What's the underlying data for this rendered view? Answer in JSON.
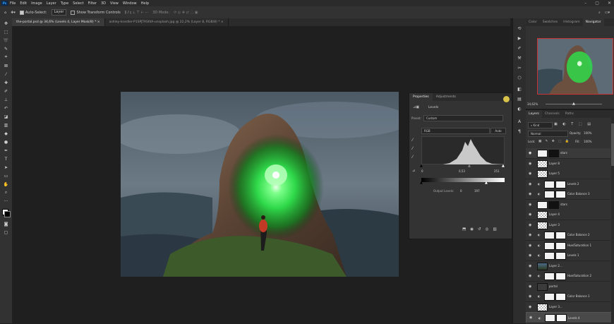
{
  "menu": {
    "app_logo": "Ps",
    "items": [
      "File",
      "Edit",
      "Image",
      "Layer",
      "Type",
      "Select",
      "Filter",
      "3D",
      "View",
      "Window",
      "Help"
    ],
    "window_controls": [
      "–",
      "▢",
      "✕"
    ]
  },
  "options_bar": {
    "auto_select_label": "Auto-Select:",
    "auto_select_value": "Layer",
    "transform_label": "Show Transform Controls",
    "mode_3d_label": "3D Mode:"
  },
  "tabs": [
    {
      "label": "the-portal.psd @ 34,6% (Levels 4, Layer Mask/8) *",
      "active": true
    },
    {
      "label": "ashley-knedler-P1SPJTASfdA-unsplash.jpg @ 22,2% (Layer 8, RGB/8) *",
      "active": false
    }
  ],
  "properties": {
    "tab_properties": "Properties",
    "tab_adjustments": "Adjustments",
    "title": "Levels",
    "preset_label": "Preset:",
    "preset_value": "Custom",
    "channel_value": "RGB",
    "auto_label": "Auto",
    "input_black": "0",
    "input_gamma": "0,53",
    "input_white": "251",
    "output_label": "Output Levels:",
    "output_black": "0",
    "output_white": "197"
  },
  "panels": {
    "tabs": [
      "Color",
      "Swatches",
      "Histogram",
      "Navigator"
    ],
    "active": "Navigator",
    "zoom": "34,62%"
  },
  "layers": {
    "tabs": [
      "Layers",
      "Channels",
      "Paths"
    ],
    "kind_label": "Kind",
    "blend_mode": "Normal",
    "opacity_label": "Opacity:",
    "opacity_value": "100%",
    "lock_label": "Lock:",
    "fill_label": "Fill:",
    "fill_value": "100%",
    "rows": [
      {
        "name": "stars",
        "type": "mask"
      },
      {
        "name": "Layer 8",
        "type": "pixel"
      },
      {
        "name": "Layer 5",
        "type": "pixel"
      },
      {
        "name": "Levels 2",
        "type": "adjust"
      },
      {
        "name": "Color Balance 3",
        "type": "adjust"
      },
      {
        "name": "stars",
        "type": "mask"
      },
      {
        "name": "Layer 4",
        "type": "pixel"
      },
      {
        "name": "Layer 3",
        "type": "pixel"
      },
      {
        "name": "Color Balance 2",
        "type": "adjust"
      },
      {
        "name": "Hue/Saturation 1",
        "type": "adjust"
      },
      {
        "name": "Levels 1",
        "type": "adjust"
      },
      {
        "name": "Layer 2...",
        "type": "photo"
      },
      {
        "name": "Hue/Saturation 2",
        "type": "adjust"
      },
      {
        "name": "portal",
        "type": "group"
      },
      {
        "name": "Color Balance 1",
        "type": "adjust"
      },
      {
        "name": "Layer 3...",
        "type": "pixel"
      },
      {
        "name": "Levels 4",
        "type": "adjust"
      }
    ]
  },
  "colors": {
    "portal_glow": "#3cff5a",
    "selection_red": "#c83232",
    "panel_bg": "#323232",
    "canvas_bg": "#1f1f1f"
  }
}
